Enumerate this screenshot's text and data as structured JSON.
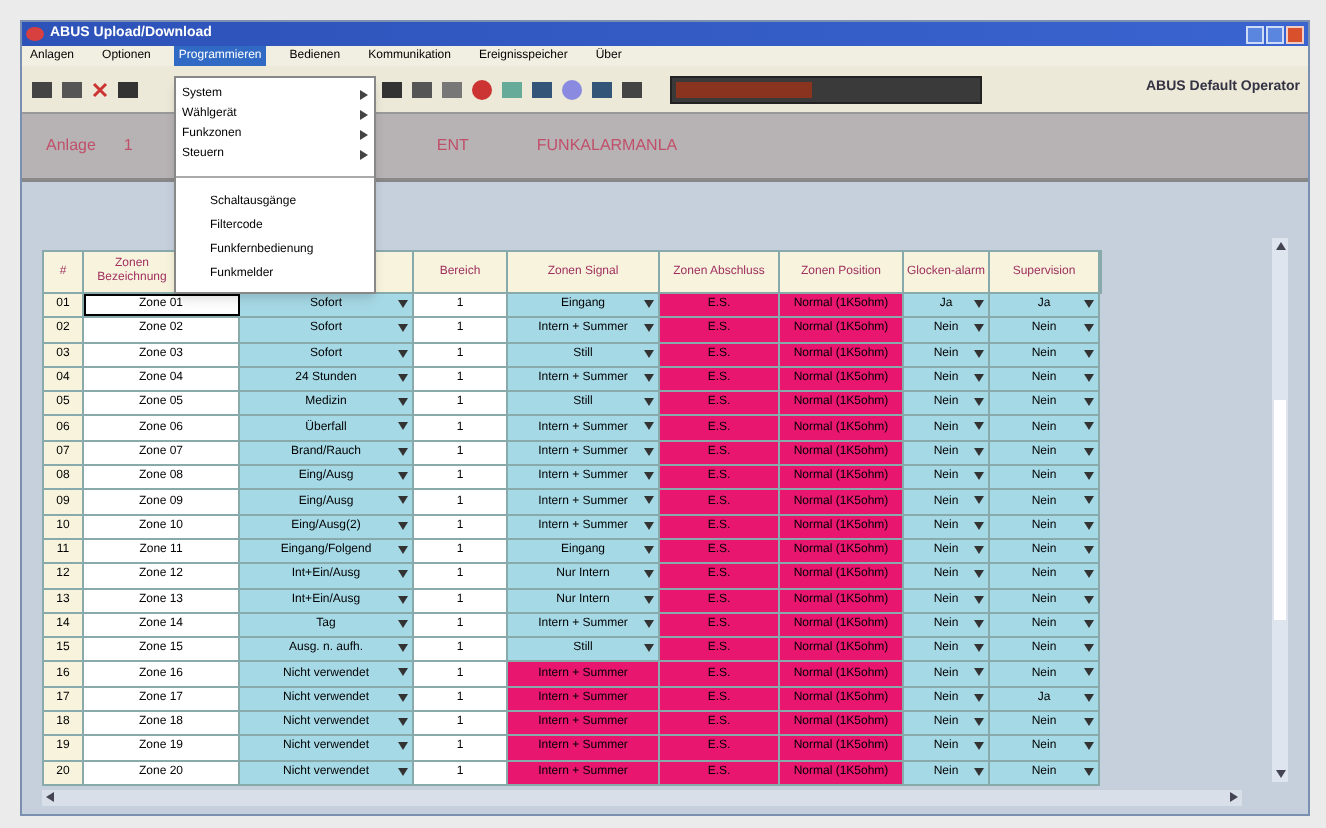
{
  "window": {
    "title": "ABUS Upload/Download"
  },
  "menu_bar": [
    {
      "label": "Anlagen",
      "selected": false
    },
    {
      "label": "Optionen",
      "selected": false
    },
    {
      "label": "Programmieren",
      "selected": true
    },
    {
      "label": "Bedienen",
      "selected": false
    },
    {
      "label": "Kommunikation",
      "selected": false
    },
    {
      "label": "Ereignisspeicher",
      "selected": false
    },
    {
      "label": "Über",
      "selected": false
    }
  ],
  "open_menu": {
    "submenus": [
      "System",
      "Wählgerät",
      "Funkzonen",
      "Steuern"
    ],
    "actions": [
      "Schaltausgänge",
      "Filtercode",
      "Funkfernbedienung",
      "Funkmelder"
    ]
  },
  "toolbar": {
    "progress": {
      "level": 0.45
    },
    "operator": "ABUS Default Operator"
  },
  "header": {
    "label": "Anlage",
    "number": "1",
    "fragment": "ENT",
    "system_name": "FUNKALARMANLA"
  },
  "table": {
    "columns_left": [
      {
        "label": "#"
      },
      {
        "label": "Zonen Bezeichnung"
      }
    ],
    "columns": [
      {
        "label": "Bereich"
      },
      {
        "label": "Zonen Signal"
      },
      {
        "label": "Zonen Abschluss"
      },
      {
        "label": "Zonen Position"
      },
      {
        "label": "Glocken-alarm"
      },
      {
        "label": "Supervision"
      }
    ],
    "rows": [
      {
        "no": "01",
        "name": "Zone 01",
        "type": "Sofort",
        "area": "1",
        "signal": "Eingang",
        "signal_locked": false,
        "alarm": "E.S.",
        "position": "Normal (1K5ohm)",
        "bell": "Ja",
        "supervision": "Ja",
        "selected": true
      },
      {
        "no": "02",
        "name": "Zone 02",
        "type": "Sofort",
        "area": "1",
        "signal": "Intern + Summer",
        "signal_locked": false,
        "alarm": "E.S.",
        "position": "Normal (1K5ohm)",
        "bell": "Nein",
        "supervision": "Nein",
        "selected": false
      },
      {
        "no": "03",
        "name": "Zone 03",
        "type": "Sofort",
        "area": "1",
        "signal": "Still",
        "signal_locked": false,
        "alarm": "E.S.",
        "position": "Normal (1K5ohm)",
        "bell": "Nein",
        "supervision": "Nein",
        "selected": false
      },
      {
        "no": "04",
        "name": "Zone 04",
        "type": "24 Stunden",
        "area": "1",
        "signal": "Intern + Summer",
        "signal_locked": false,
        "alarm": "E.S.",
        "position": "Normal (1K5ohm)",
        "bell": "Nein",
        "supervision": "Nein",
        "selected": false
      },
      {
        "no": "05",
        "name": "Zone 05",
        "type": "Medizin",
        "area": "1",
        "signal": "Still",
        "signal_locked": false,
        "alarm": "E.S.",
        "position": "Normal (1K5ohm)",
        "bell": "Nein",
        "supervision": "Nein",
        "selected": false
      },
      {
        "no": "06",
        "name": "Zone 06",
        "type": "Überfall",
        "area": "1",
        "signal": "Intern + Summer",
        "signal_locked": false,
        "alarm": "E.S.",
        "position": "Normal (1K5ohm)",
        "bell": "Nein",
        "supervision": "Nein",
        "selected": false
      },
      {
        "no": "07",
        "name": "Zone 07",
        "type": "Brand/Rauch",
        "area": "1",
        "signal": "Intern + Summer",
        "signal_locked": false,
        "alarm": "E.S.",
        "position": "Normal (1K5ohm)",
        "bell": "Nein",
        "supervision": "Nein",
        "selected": false
      },
      {
        "no": "08",
        "name": "Zone 08",
        "type": "Eing/Ausg",
        "area": "1",
        "signal": "Intern + Summer",
        "signal_locked": false,
        "alarm": "E.S.",
        "position": "Normal (1K5ohm)",
        "bell": "Nein",
        "supervision": "Nein",
        "selected": false
      },
      {
        "no": "09",
        "name": "Zone 09",
        "type": "Eing/Ausg",
        "area": "1",
        "signal": "Intern + Summer",
        "signal_locked": false,
        "alarm": "E.S.",
        "position": "Normal (1K5ohm)",
        "bell": "Nein",
        "supervision": "Nein",
        "selected": false
      },
      {
        "no": "10",
        "name": "Zone 10",
        "type": "Eing/Ausg(2)",
        "area": "1",
        "signal": "Intern + Summer",
        "signal_locked": false,
        "alarm": "E.S.",
        "position": "Normal (1K5ohm)",
        "bell": "Nein",
        "supervision": "Nein",
        "selected": false
      },
      {
        "no": "11",
        "name": "Zone 11",
        "type": "Eingang/Folgend",
        "area": "1",
        "signal": "Eingang",
        "signal_locked": false,
        "alarm": "E.S.",
        "position": "Normal (1K5ohm)",
        "bell": "Nein",
        "supervision": "Nein",
        "selected": false
      },
      {
        "no": "12",
        "name": "Zone 12",
        "type": "Int+Ein/Ausg",
        "area": "1",
        "signal": "Nur Intern",
        "signal_locked": false,
        "alarm": "E.S.",
        "position": "Normal (1K5ohm)",
        "bell": "Nein",
        "supervision": "Nein",
        "selected": false
      },
      {
        "no": "13",
        "name": "Zone 13",
        "type": "Int+Ein/Ausg",
        "area": "1",
        "signal": "Nur Intern",
        "signal_locked": false,
        "alarm": "E.S.",
        "position": "Normal (1K5ohm)",
        "bell": "Nein",
        "supervision": "Nein",
        "selected": false
      },
      {
        "no": "14",
        "name": "Zone 14",
        "type": "Tag",
        "area": "1",
        "signal": "Intern + Summer",
        "signal_locked": false,
        "alarm": "E.S.",
        "position": "Normal (1K5ohm)",
        "bell": "Nein",
        "supervision": "Nein",
        "selected": false
      },
      {
        "no": "15",
        "name": "Zone 15",
        "type": "Ausg. n. aufh.",
        "area": "1",
        "signal": "Still",
        "signal_locked": false,
        "alarm": "E.S.",
        "position": "Normal (1K5ohm)",
        "bell": "Nein",
        "supervision": "Nein",
        "selected": false
      },
      {
        "no": "16",
        "name": "Zone 16",
        "type": "Nicht verwendet",
        "area": "1",
        "signal": "Intern + Summer",
        "signal_locked": true,
        "alarm": "E.S.",
        "position": "Normal (1K5ohm)",
        "bell": "Nein",
        "supervision": "Nein",
        "selected": false
      },
      {
        "no": "17",
        "name": "Zone 17",
        "type": "Nicht verwendet",
        "area": "1",
        "signal": "Intern + Summer",
        "signal_locked": true,
        "alarm": "E.S.",
        "position": "Normal (1K5ohm)",
        "bell": "Nein",
        "supervision": "Ja",
        "selected": false
      },
      {
        "no": "18",
        "name": "Zone 18",
        "type": "Nicht verwendet",
        "area": "1",
        "signal": "Intern + Summer",
        "signal_locked": true,
        "alarm": "E.S.",
        "position": "Normal (1K5ohm)",
        "bell": "Nein",
        "supervision": "Nein",
        "selected": false
      },
      {
        "no": "19",
        "name": "Zone 19",
        "type": "Nicht verwendet",
        "area": "1",
        "signal": "Intern + Summer",
        "signal_locked": true,
        "alarm": "E.S.",
        "position": "Normal (1K5ohm)",
        "bell": "Nein",
        "supervision": "Nein",
        "selected": false
      },
      {
        "no": "20",
        "name": "Zone 20",
        "type": "Nicht verwendet",
        "area": "1",
        "signal": "Intern + Summer",
        "signal_locked": true,
        "alarm": "E.S.",
        "position": "Normal (1K5ohm)",
        "bell": "Nein",
        "supervision": "Nein",
        "selected": false
      }
    ]
  }
}
